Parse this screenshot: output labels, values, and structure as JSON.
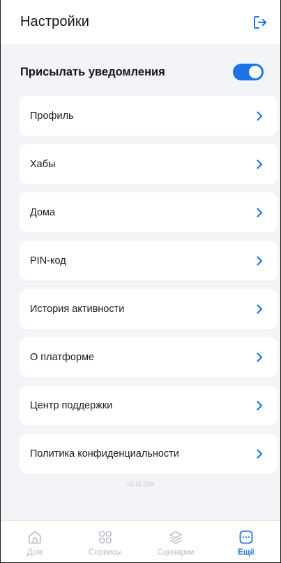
{
  "header": {
    "title": "Настройки"
  },
  "notifications": {
    "label": "Присылать уведомления",
    "enabled": true
  },
  "menu": [
    {
      "label": "Профиль"
    },
    {
      "label": "Хабы"
    },
    {
      "label": "Дома"
    },
    {
      "label": "PIN-код"
    },
    {
      "label": "История активности"
    },
    {
      "label": "О платформе"
    },
    {
      "label": "Центр поддержки"
    },
    {
      "label": "Политика конфиденциальности"
    }
  ],
  "version": "v2.11.29a",
  "tabbar": [
    {
      "label": "Дом",
      "icon": "home-icon",
      "active": false
    },
    {
      "label": "Сервисы",
      "icon": "grid-icon",
      "active": false
    },
    {
      "label": "Сценарии",
      "icon": "layers-icon",
      "active": false
    },
    {
      "label": "Ещё",
      "icon": "more-icon",
      "active": true
    }
  ],
  "colors": {
    "accent": "#1e73e6",
    "inactive": "#b9bcc6",
    "background": "#f3f4f8"
  }
}
